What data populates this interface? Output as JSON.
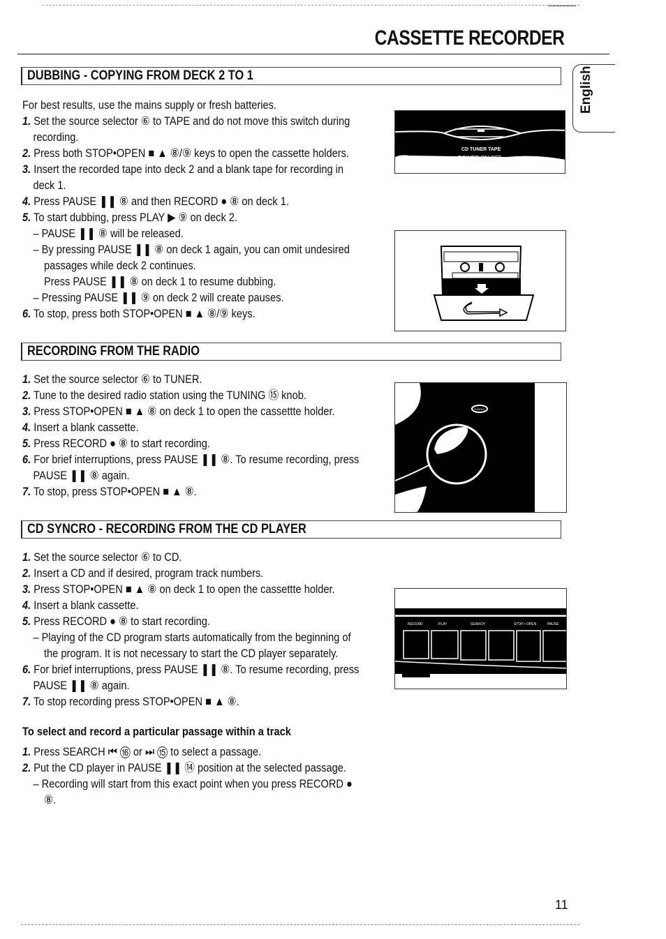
{
  "header": {
    "title": "CASSETTE RECORDER",
    "language_tab": "English"
  },
  "sections": [
    {
      "heading": "DUBBING - COPYING FROM DECK 2 TO 1",
      "lines": [
        {
          "n": "",
          "text": "For best results, use the mains supply or fresh batteries.",
          "indent": 0
        },
        {
          "n": "1.",
          "text": "Set the source selector ⑥ to TAPE and do not move this switch during",
          "indent": 0
        },
        {
          "n": "",
          "text": "recording.",
          "indent": 1
        },
        {
          "n": "2.",
          "text": "Press both STOP•OPEN ■ ▲ ⑧/⑨ keys to open the cassette holders.",
          "indent": 0
        },
        {
          "n": "3.",
          "text": "Insert the recorded tape into deck 2 and a blank tape for recording in",
          "indent": 0
        },
        {
          "n": "",
          "text": "deck 1.",
          "indent": 1
        },
        {
          "n": "4.",
          "text": "Press PAUSE ❚❚ ⑧ and then RECORD ● ⑧ on deck 1.",
          "indent": 0
        },
        {
          "n": "5.",
          "text": "To start dubbing, press PLAY ▶ ⑨ on deck 2.",
          "indent": 0
        },
        {
          "n": "",
          "text": "– PAUSE ❚❚ ⑧ will be released.",
          "indent": 2
        },
        {
          "n": "",
          "text": "– By pressing PAUSE ❚❚ ⑧ on deck 1 again, you can omit undesired",
          "indent": 2
        },
        {
          "n": "",
          "text": "passages while deck 2 continues.",
          "indent": 3
        },
        {
          "n": "",
          "text": "Press PAUSE ❚❚ ⑧ on deck 1 to resume dubbing.",
          "indent": 3
        },
        {
          "n": "",
          "text": "– Pressing PAUSE ❚❚ ⑨ on deck 2 will create pauses.",
          "indent": 2
        },
        {
          "n": "6.",
          "text": "To stop, press both STOP•OPEN ■ ▲ ⑧/⑨ keys.",
          "indent": 0
        }
      ]
    },
    {
      "heading": "RECORDING FROM THE RADIO",
      "lines": [
        {
          "n": "1.",
          "text": "Set the source selector ⑥ to TUNER.",
          "indent": 0
        },
        {
          "n": "2.",
          "text": "Tune to the desired radio station using the TUNING ⑮ knob.",
          "indent": 0
        },
        {
          "n": "3.",
          "text": "Press STOP•OPEN ■ ▲ ⑧ on deck 1 to open the cassettte holder.",
          "indent": 0
        },
        {
          "n": "4.",
          "text": "Insert a blank cassette.",
          "indent": 0
        },
        {
          "n": "5.",
          "text": "Press RECORD ● ⑧ to start recording.",
          "indent": 0
        },
        {
          "n": "6.",
          "text": "For brief interruptions, press PAUSE ❚❚ ⑧. To resume recording, press",
          "indent": 0
        },
        {
          "n": "",
          "text": "PAUSE ❚❚ ⑧ again.",
          "indent": 1
        },
        {
          "n": "7.",
          "text": "To stop, press STOP•OPEN ■ ▲ ⑧.",
          "indent": 0
        }
      ]
    },
    {
      "heading": "CD SYNCRO - RECORDING FROM THE CD PLAYER",
      "lines": [
        {
          "n": "1.",
          "text": "Set the source selector ⑥ to CD.",
          "indent": 0
        },
        {
          "n": "2.",
          "text": "Insert a CD and if desired, program track numbers.",
          "indent": 0
        },
        {
          "n": "3.",
          "text": "Press STOP•OPEN ■ ▲ ⑧ on deck 1 to open the cassettte holder.",
          "indent": 0
        },
        {
          "n": "4.",
          "text": "Insert a blank cassette.",
          "indent": 0
        },
        {
          "n": "5.",
          "text": "Press RECORD ● ⑧ to start recording.",
          "indent": 0
        },
        {
          "n": "",
          "text": "– Playing of the CD program starts automatically from the beginning of",
          "indent": 2
        },
        {
          "n": "",
          "text": "the program. It is not necessary to start the CD player separately.",
          "indent": 3
        },
        {
          "n": "6.",
          "text": "For brief interruptions, press PAUSE ❚❚ ⑧. To resume recording, press",
          "indent": 0
        },
        {
          "n": "",
          "text": "PAUSE ❚❚ ⑧ again.",
          "indent": 1
        },
        {
          "n": "7.",
          "text": "To stop recording press STOP•OPEN ■ ▲ ⑧.",
          "indent": 0
        }
      ],
      "subsection": {
        "heading": "To select and record a particular passage within a track",
        "lines": [
          {
            "n": "1.",
            "text": "Press SEARCH ⏮ ⑯ or ⏭ ⑮ to select a passage.",
            "indent": 0
          },
          {
            "n": "2.",
            "text": "Put the CD player in PAUSE ❚❚ ⑭ position at the selected passage.",
            "indent": 0
          },
          {
            "n": "",
            "text": "– Recording will start from this exact point when you press RECORD ●",
            "indent": 2
          },
          {
            "n": "",
            "text": "⑧.",
            "indent": 3
          }
        ]
      }
    }
  ],
  "figures": {
    "selector": {
      "labels": [
        "CD",
        "TUNER",
        "TAPE"
      ],
      "power_label": "POWER ON OFF"
    },
    "cassette": {
      "description": "cassette-holder-open"
    },
    "tuning": {
      "label": "TUNING"
    },
    "deck_buttons": {
      "labels": [
        "RECORD",
        "PLAY",
        "SEARCH",
        "STOP • OPEN",
        "PAUSE"
      ]
    }
  },
  "footer": {
    "page_number": "11"
  }
}
